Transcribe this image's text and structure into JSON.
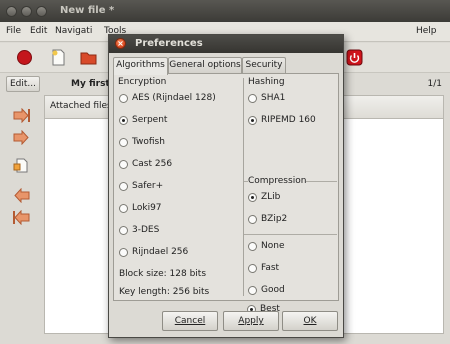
{
  "main_window": {
    "title": "New file *",
    "menu": [
      "File",
      "Edit",
      "Navigati",
      "Tools",
      "Help"
    ],
    "edit_label": "Edit...",
    "document_label": "My first",
    "page_count": "1/1",
    "attached_files_label": "Attached files"
  },
  "dialog": {
    "title": "Preferences",
    "tabs": [
      "Algorithms",
      "General options",
      "Security"
    ],
    "active_tab": "Algorithms",
    "encryption": {
      "label": "Encryption",
      "options": [
        "AES (Rijndael 128)",
        "Serpent",
        "Twofish",
        "Cast 256",
        "Safer+",
        "Loki97",
        "3-DES",
        "Rijndael 256"
      ],
      "selected": "Serpent",
      "block_size": "Block size: 128 bits",
      "key_length": "Key length: 256 bits"
    },
    "hashing": {
      "label": "Hashing",
      "options": [
        "SHA1",
        "RIPEMD 160"
      ],
      "selected": "RIPEMD 160"
    },
    "compression": {
      "label": "Compression",
      "options": [
        "ZLib",
        "BZip2"
      ],
      "selected": "ZLib"
    },
    "level": {
      "options": [
        "None",
        "Fast",
        "Good",
        "Best"
      ],
      "selected": "Best"
    },
    "buttons": {
      "cancel": "Cancel",
      "apply": "Apply",
      "ok": "OK"
    }
  },
  "colors": {
    "close_button": "#d8441c",
    "titlebar": "#3c3b37",
    "window_bg": "#dcdad4"
  }
}
